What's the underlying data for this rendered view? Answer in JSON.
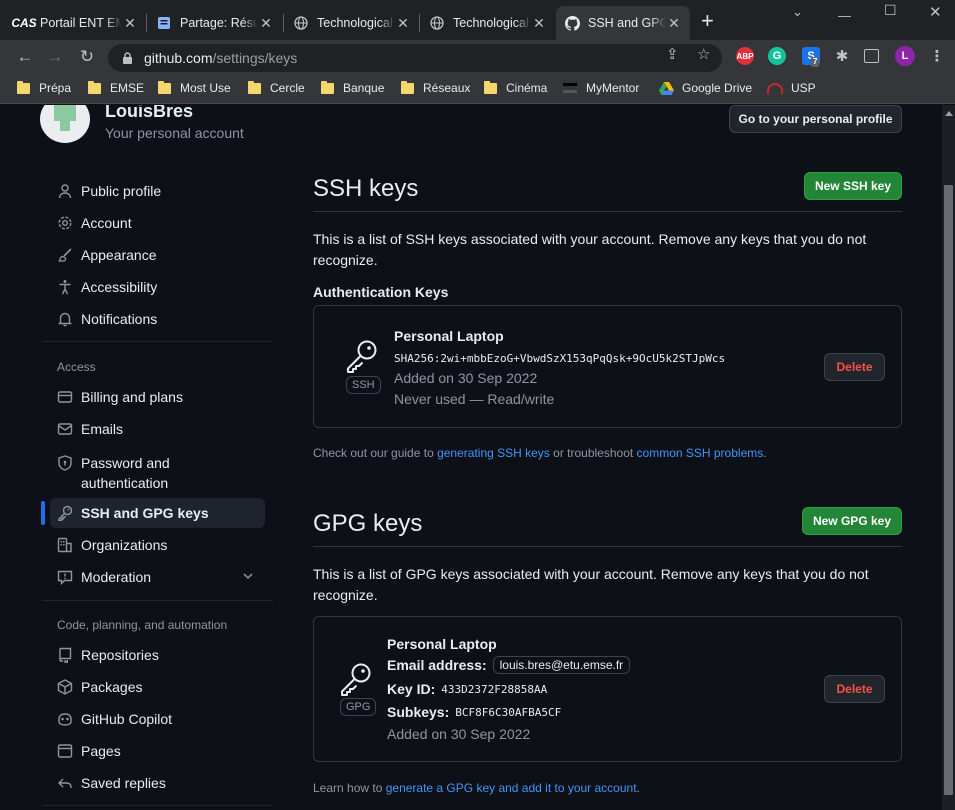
{
  "browser": {
    "tabs": [
      {
        "title": "Portail ENT EMSE",
        "icon": "cas-icon",
        "fav_text": "CAS"
      },
      {
        "title": "Partage: Résumé",
        "icon": "document-icon"
      },
      {
        "title": "Technological",
        "icon": "globe-icon"
      },
      {
        "title": "Technological",
        "icon": "globe-icon"
      },
      {
        "title": "SSH and GPG keys",
        "icon": "github-icon"
      }
    ],
    "url_host": "github.com",
    "url_path": "/settings/keys",
    "extensions": [
      {
        "name": "adblock-plus-icon",
        "text": "ABP",
        "color": "#e0313b"
      },
      {
        "name": "grammarly-icon",
        "text": "G",
        "color": "#15c39a"
      },
      {
        "name": "extension-s-icon",
        "text": "S",
        "color": "#1a73e8",
        "badge": "7"
      }
    ],
    "profile_initial": "L",
    "bookmarks": [
      "Prépa",
      "EMSE",
      "Most Use",
      "Cercle",
      "Banque",
      "Réseaux",
      "Cinéma",
      "MyMentor",
      "Google Drive",
      "USP"
    ]
  },
  "profile": {
    "username": "LouisBres",
    "subtitle": "Your personal account",
    "profile_button": "Go to your personal profile"
  },
  "sidebar": {
    "items": [
      {
        "label": "Public profile",
        "icon": "person-icon"
      },
      {
        "label": "Account",
        "icon": "gear-icon"
      },
      {
        "label": "Appearance",
        "icon": "paintbrush-icon"
      },
      {
        "label": "Accessibility",
        "icon": "accessibility-icon"
      },
      {
        "label": "Notifications",
        "icon": "bell-icon"
      }
    ],
    "access_heading": "Access",
    "access_items": [
      {
        "label": "Billing and plans",
        "icon": "credit-card-icon"
      },
      {
        "label": "Emails",
        "icon": "mail-icon"
      },
      {
        "label": "Password and authentication",
        "icon": "shield-lock-icon"
      },
      {
        "label": "SSH and GPG keys",
        "icon": "key-icon",
        "active": true
      },
      {
        "label": "Organizations",
        "icon": "organization-icon"
      },
      {
        "label": "Moderation",
        "icon": "report-icon",
        "expandable": true
      }
    ],
    "code_heading": "Code, planning, and automation",
    "code_items": [
      {
        "label": "Repositories",
        "icon": "repo-icon"
      },
      {
        "label": "Packages",
        "icon": "package-icon"
      },
      {
        "label": "GitHub Copilot",
        "icon": "copilot-icon"
      },
      {
        "label": "Pages",
        "icon": "browser-icon"
      },
      {
        "label": "Saved replies",
        "icon": "reply-icon"
      }
    ]
  },
  "ssh": {
    "title": "SSH keys",
    "new_button": "New SSH key",
    "description": "This is a list of SSH keys associated with your account. Remove any keys that you do not recognize.",
    "auth_heading": "Authentication Keys",
    "key": {
      "name": "Personal Laptop",
      "fingerprint": "SHA256:2wi+mbbEzoG+VbwdSzX153qPqQsk+9OcU5k2STJpWcs",
      "added": "Added on 30 Sep 2022",
      "usage": "Never used — Read/write",
      "badge": "SSH",
      "delete_label": "Delete"
    },
    "note_prefix": "Check out our guide to ",
    "note_link1": "generating SSH keys",
    "note_mid": " or troubleshoot ",
    "note_link2": "common SSH problems",
    "note_suffix": "."
  },
  "gpg": {
    "title": "GPG keys",
    "new_button": "New GPG key",
    "description": "This is a list of GPG keys associated with your account. Remove any keys that you do not recognize.",
    "key": {
      "name": "Personal Laptop",
      "email_label": "Email address:",
      "email": "louis.bres@etu.emse.fr",
      "keyid_label": "Key ID:",
      "keyid": "433D2372F28858AA",
      "subkeys_label": "Subkeys:",
      "subkeys": "BCF8F6C30AFBA5CF",
      "added": "Added on 30 Sep 2022",
      "badge": "GPG",
      "delete_label": "Delete"
    },
    "note_prefix": "Learn how to ",
    "note_link": "generate a GPG key and add it to your account",
    "note_suffix": "."
  },
  "colors": {
    "accent": "#1f6feb",
    "green": "#238636",
    "danger": "#f85149",
    "link": "#4493f8",
    "background": "#0d1117"
  }
}
